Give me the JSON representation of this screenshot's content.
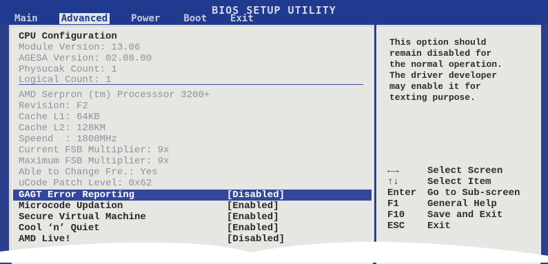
{
  "header": {
    "title": "BIOS SETUP UTILITY",
    "menu": [
      {
        "label": "Main",
        "active": false
      },
      {
        "label": "Advanced",
        "active": true
      },
      {
        "label": "Power",
        "active": false
      },
      {
        "label": "Boot",
        "active": false
      },
      {
        "label": "Exit",
        "active": false
      }
    ]
  },
  "cpu_info": {
    "section_title": "CPU Configuration",
    "module_version": "Module Version: 13.06",
    "agesa_version": "AGESA Version: 02.08.00",
    "physical_count": "Physucak Count: 1",
    "logical_count": "Logical Count: 1",
    "processor": "AMD Serpron (tm) Processsor 3200+",
    "revision": "Revision: F2",
    "cache_l1": "Cache L1: 64KB",
    "cache_l2": "Cache L2: 128KM",
    "speed": "Speend  : 1800MHz",
    "current_fsb": "Current FSB Multiplier: 9x",
    "maximum_fsb": "Maximum FSB Multiplier: 9x",
    "able_change": "Able to Change Fre.: Yes",
    "ucode_patch": "uCode Patch Level: 0x62"
  },
  "settings": [
    {
      "label": "GAGT Error Reporting",
      "value": "[Disabled]",
      "selected": true
    },
    {
      "label": "Microcode Updation",
      "value": "[Enabled]",
      "selected": false
    },
    {
      "label": "Secure Virtual Machine",
      "value": "[Enabled]",
      "selected": false
    },
    {
      "label": "Cool ‘n’ Quiet",
      "value": "[Enabled]",
      "selected": false
    },
    {
      "label": "AMD Live!",
      "value": "[Disabled]",
      "selected": false
    }
  ],
  "help": {
    "text": "This option should\nremain disabled for\nthe normal operation.\nThe driver developer\nmay enable it for\ntexting purpose."
  },
  "keys": [
    {
      "key": "←→",
      "desc": "Select Screen"
    },
    {
      "key": "↑↓",
      "desc": "Select Item"
    },
    {
      "key": "Enter",
      "desc": "Go to Sub-screen"
    },
    {
      "key": "F1",
      "desc": "General Help"
    },
    {
      "key": "F10",
      "desc": "Save and Exit"
    },
    {
      "key": "ESC",
      "desc": "Exit"
    }
  ],
  "colors": {
    "background": "#2b3f8d",
    "panel": "#e6e6e2",
    "highlight": "#33479a",
    "tab_active": "#e5e5e0"
  }
}
